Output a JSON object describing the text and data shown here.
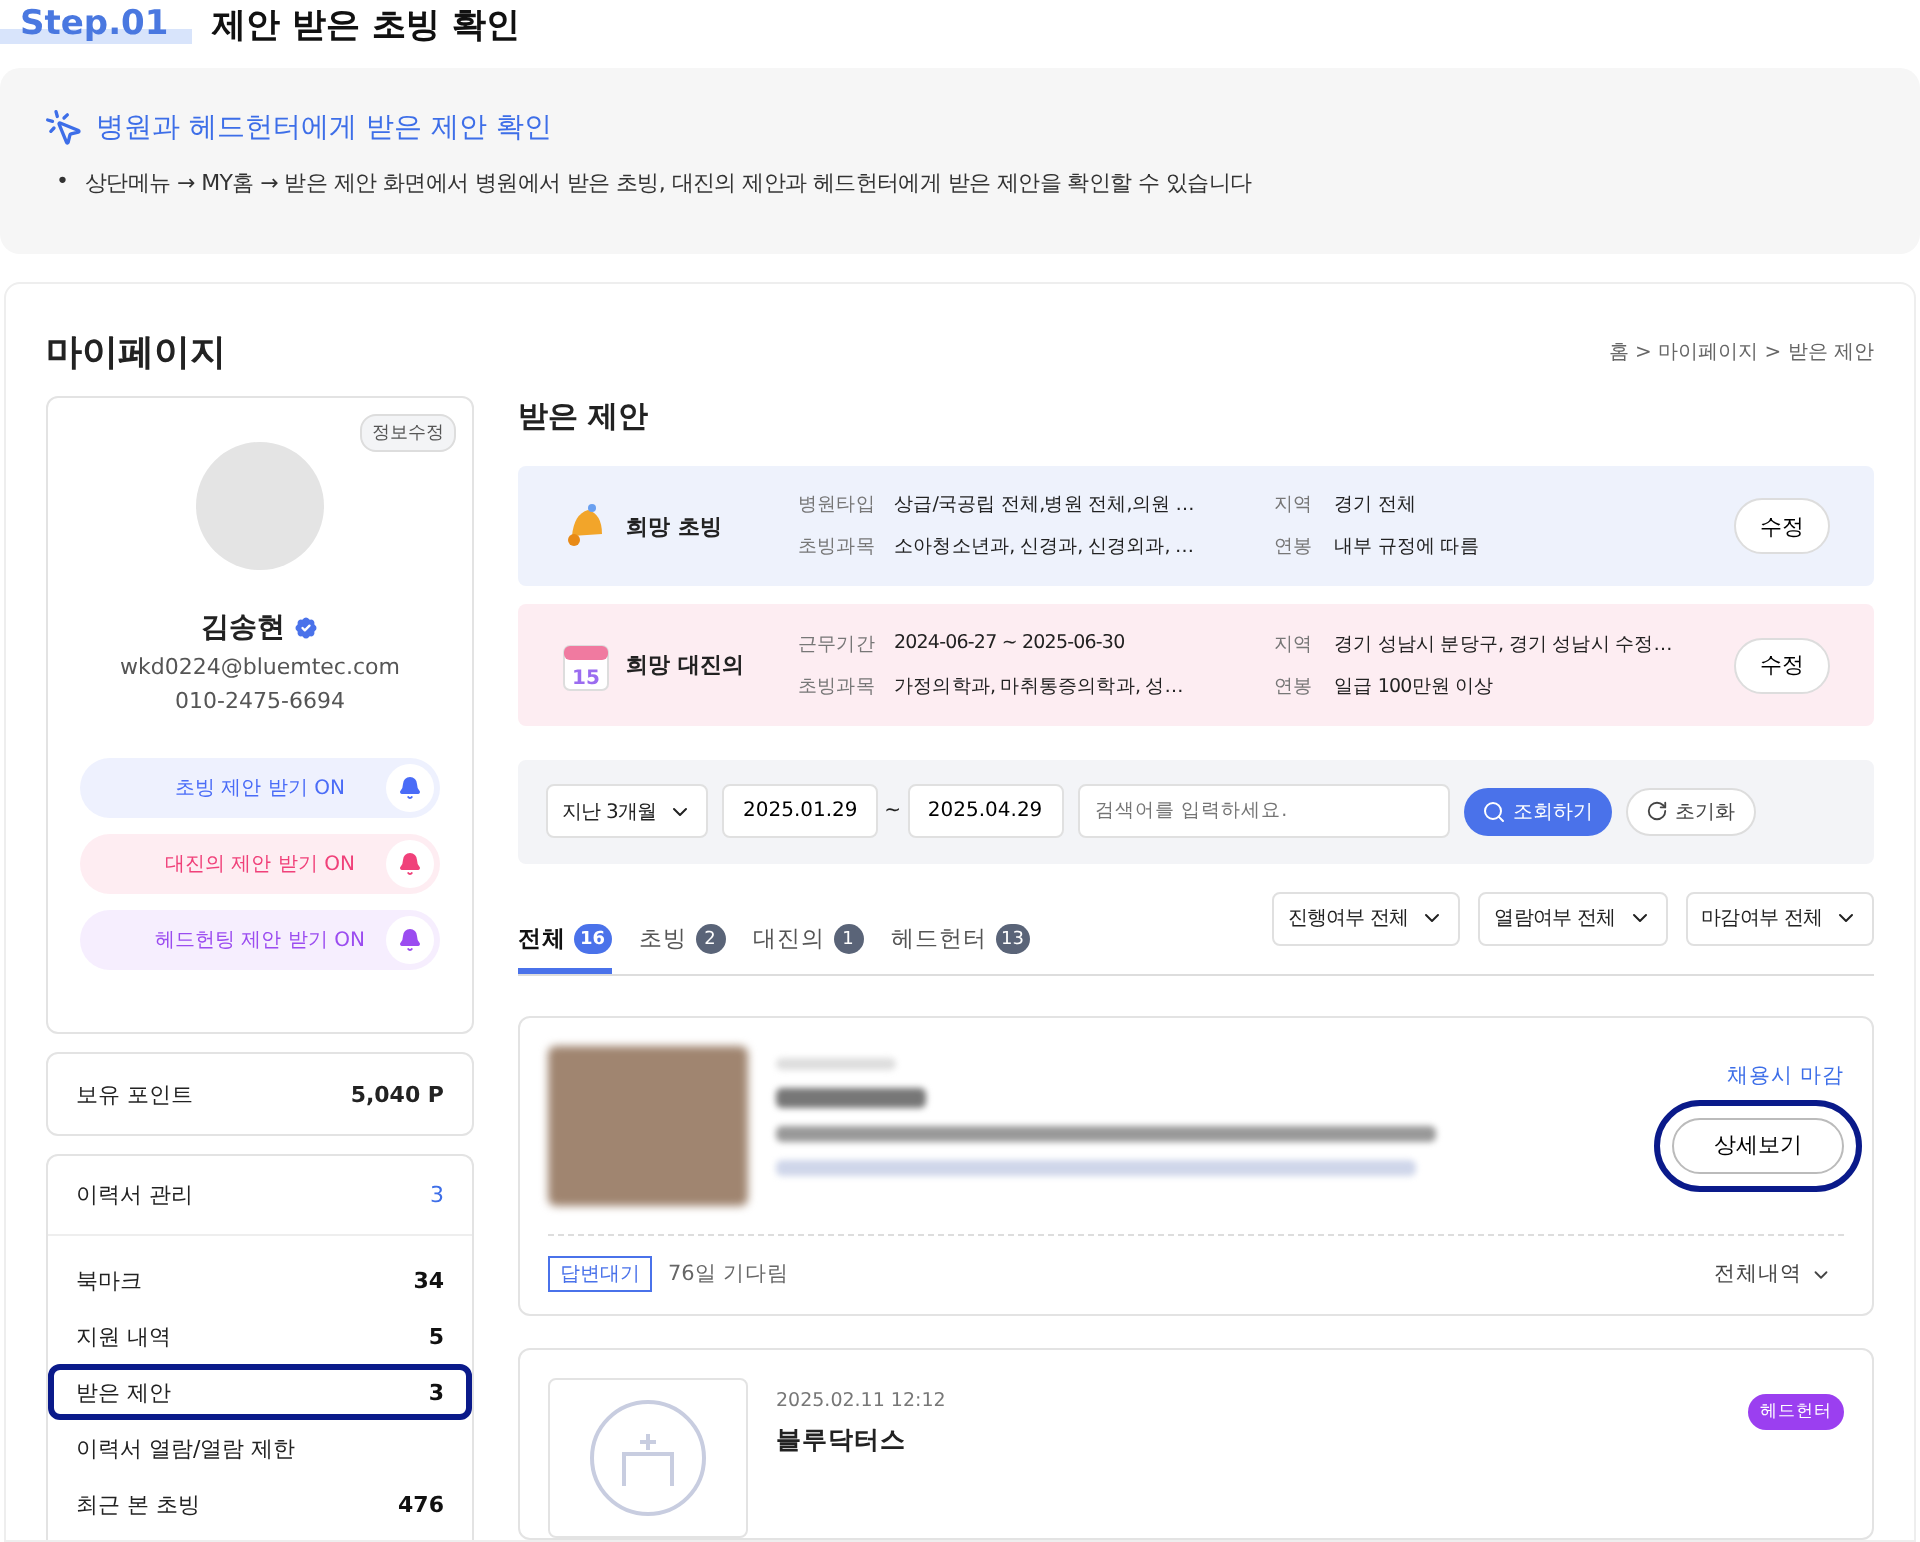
{
  "step": {
    "label": "Step.01",
    "title": "제안 받은 초빙 확인"
  },
  "guide": {
    "title": "병원과 헤드헌터에게 받은 제안 확인",
    "bullets": [
      {
        "marker": "•",
        "text": "상단메뉴 → MY홈 → 받은 제안 화면에서 병원에서 받은 초빙, 대진의 제안과 헤드헌터에게 받은 제안을 확인할 수 있습니다"
      }
    ]
  },
  "mypage": {
    "title": "마이페이지",
    "breadcrumb": "홈 > 마이페이지 > 받은 제안"
  },
  "profile": {
    "edit_button": "정보수정",
    "name": "김송현",
    "verified": true,
    "email": "wkd0224@bluemtec.com",
    "phone": "010-2475-6694",
    "toggles": [
      {
        "label": "초빙 제안 받기 ON",
        "color": "#4a6cf7",
        "on": true
      },
      {
        "label": "대진의 제안 받기 ON",
        "color": "#f0417a",
        "on": true
      },
      {
        "label": "헤드헌팅 제안 받기 ON",
        "color": "#9b4cf0",
        "on": true
      }
    ]
  },
  "points": {
    "label": "보유 포인트",
    "value": "5,040 P"
  },
  "menu": [
    {
      "label": "이력서 관리",
      "count": "3",
      "accent": true,
      "highlighted": false
    },
    {
      "label": "북마크",
      "count": "34",
      "accent": false,
      "highlighted": false
    },
    {
      "label": "지원 내역",
      "count": "5",
      "accent": false,
      "highlighted": false
    },
    {
      "label": "받은 제안",
      "count": "3",
      "accent": false,
      "highlighted": true
    },
    {
      "label": "이력서 열람/열람 제한",
      "highlighted": false
    },
    {
      "label": "최근 본 초빙",
      "count": "476",
      "accent": false,
      "highlighted": false
    }
  ],
  "offers": {
    "title": "받은 제안",
    "preferences": [
      {
        "kind": "recruit",
        "title": "희망 초빙",
        "button": "수정",
        "fields": [
          {
            "label": "병원타입",
            "value": "상급/국공립 전체,병원 전체,의원 …"
          },
          {
            "label": "지역",
            "value": "경기 전체"
          },
          {
            "label": "초빙과목",
            "value": "소아청소년과, 신경과, 신경외과, …"
          },
          {
            "label": "연봉",
            "value": "내부 규정에 따름"
          }
        ]
      },
      {
        "kind": "locum",
        "title": "희망 대진의",
        "button": "수정",
        "icon_text": "15",
        "fields": [
          {
            "label": "근무기간",
            "value": "2024-06-27 ~ 2025-06-30"
          },
          {
            "label": "지역",
            "value": "경기 성남시 분당구, 경기 성남시 수정…"
          },
          {
            "label": "초빙과목",
            "value": "가정의학과, 마취통증의학과, 성…"
          },
          {
            "label": "연봉",
            "value": "일급 100만원 이상"
          }
        ]
      }
    ],
    "filter": {
      "period": "지난 3개월",
      "start": "2025.01.29",
      "separator": "~",
      "end": "2025.04.29",
      "placeholder": "검색어를 입력하세요.",
      "search_button": "조회하기",
      "reset_button": "초기화"
    },
    "tabs": [
      {
        "label": "전체",
        "count": "16",
        "selected": true
      },
      {
        "label": "초빙",
        "count": "2",
        "selected": false
      },
      {
        "label": "대진의",
        "count": "1",
        "selected": false
      },
      {
        "label": "헤드헌터",
        "count": "13",
        "selected": false
      }
    ],
    "dropdowns": [
      "진행여부 전체",
      "열람여부 전체",
      "마감여부 전체"
    ],
    "cards": [
      {
        "kind": "blurred",
        "status": "채용시 마감",
        "button": "상세보기",
        "highlighted": true,
        "badge": "답변대기",
        "waited": "76일 기다림",
        "history": "전체내역"
      },
      {
        "kind": "hospital",
        "date": "2025.02.11 12:12",
        "name": "블루닥터스",
        "tag": "헤드헌터"
      }
    ]
  }
}
